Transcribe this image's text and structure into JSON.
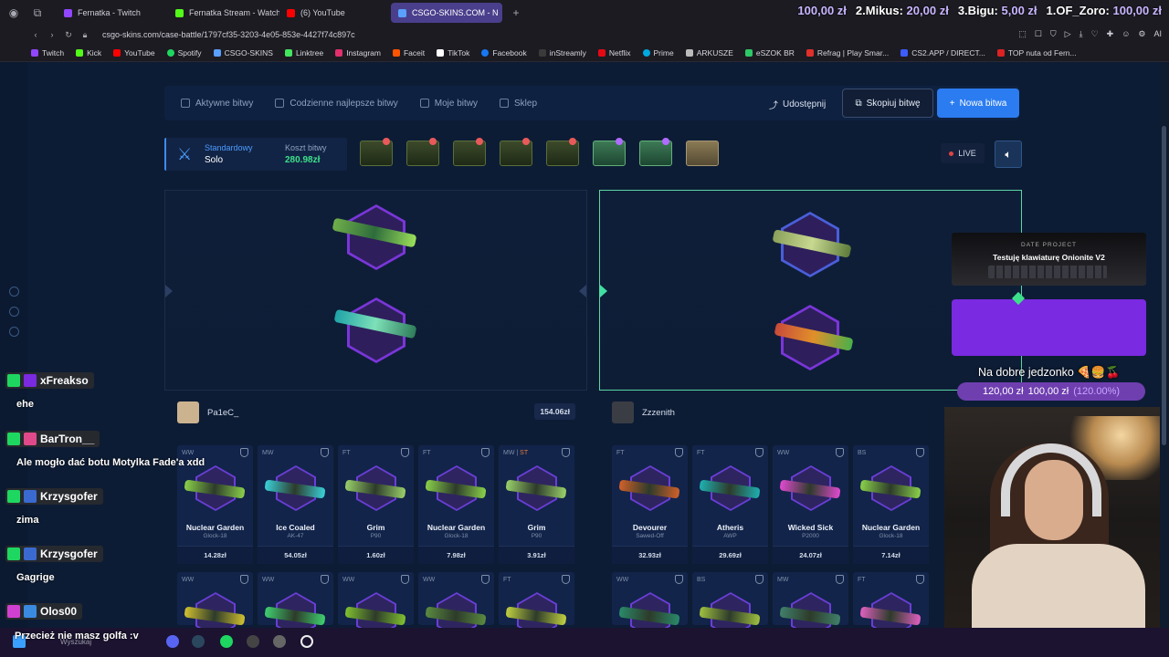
{
  "browser": {
    "tabs": [
      {
        "label": "Fernatka - Twitch",
        "color": "#9146ff"
      },
      {
        "label": "Fernatka Stream - Watch L",
        "color": "#53fc18"
      },
      {
        "label": "(6) YouTube",
        "color": "#ff0000"
      },
      {
        "label": "CSGO-SKINS.COM - N",
        "color": "#5aa0ff"
      }
    ],
    "new_tab": "+",
    "url": "csgo-skins.com/case-battle/1797cf35-3203-4e05-853e-4427f74c897c",
    "bookmarks": [
      {
        "label": "Twitch",
        "color": "#9146ff"
      },
      {
        "label": "Kick",
        "color": "#53fc18"
      },
      {
        "label": "YouTube",
        "color": "#ff0000"
      },
      {
        "label": "Spotify",
        "color": "#1ed760"
      },
      {
        "label": "CSGO-SKINS",
        "color": "#5aa0ff"
      },
      {
        "label": "Linktree",
        "color": "#43e55e"
      },
      {
        "label": "Instagram",
        "color": "#e1306c"
      },
      {
        "label": "Faceit",
        "color": "#ff5500"
      },
      {
        "label": "TikTok",
        "color": "#ffffff"
      },
      {
        "label": "Facebook",
        "color": "#1877f2"
      },
      {
        "label": "inStreamly",
        "color": "#3a3a3a"
      },
      {
        "label": "Netflix",
        "color": "#e50914"
      },
      {
        "label": "Prime",
        "color": "#00a8e1"
      },
      {
        "label": "ARKUSZE",
        "color": "#bbbbbb"
      },
      {
        "label": "eSZOK BR",
        "color": "#2ec866"
      },
      {
        "label": "Refrag | Play Smar...",
        "color": "#e0302a"
      },
      {
        "label": "CS2.APP / DIRECT...",
        "color": "#3c5cff"
      },
      {
        "label": "TOP nuta od Fern...",
        "color": "#d22"
      }
    ]
  },
  "donations": [
    {
      "name": "",
      "amount": "100,00 zł"
    },
    {
      "name": "2.Mikus:",
      "amount": "20,00 zł"
    },
    {
      "name": "3.Bigu:",
      "amount": "5,00 zł"
    },
    {
      "name": "1.OF_Zoro:",
      "amount": "100,00 zł"
    }
  ],
  "site": {
    "nav": [
      {
        "label": "Aktywne bitwy"
      },
      {
        "label": "Codzienne najlepsze bitwy"
      },
      {
        "label": "Moje bitwy"
      },
      {
        "label": "Sklep"
      }
    ],
    "share_label": "Udostępnij",
    "copy_label": "Skopiuj bitwę",
    "new_battle_label": "Nowa bitwa",
    "mode_label": "Standardowy",
    "mode_value": "Solo",
    "cost_label": "Koszt bitwy",
    "cost_value": "280.98zł",
    "live_label": "LIVE",
    "players": [
      {
        "name": "Pa1eC_",
        "total": "154.06zł",
        "items": [
          {
            "grade": "WW",
            "st": "",
            "name": "Nuclear Garden",
            "weapon": "Glock-18",
            "price": "14.28zł",
            "color": "#8ad04a"
          },
          {
            "grade": "MW",
            "st": "",
            "name": "Ice Coaled",
            "weapon": "AK-47",
            "price": "54.05zł",
            "color": "#3ad0d8"
          },
          {
            "grade": "FT",
            "st": "",
            "name": "Grim",
            "weapon": "P90",
            "price": "1.60zł",
            "color": "#9ad06a"
          },
          {
            "grade": "FT",
            "st": "",
            "name": "Nuclear Garden",
            "weapon": "Glock-18",
            "price": "7.98zł",
            "color": "#8ad04a"
          },
          {
            "grade": "MW |",
            "st": "ST",
            "name": "Grim",
            "weapon": "P90",
            "price": "3.91zł",
            "color": "#9ad06a"
          }
        ]
      },
      {
        "name": "Zzzenith",
        "total": "",
        "items": [
          {
            "grade": "FT",
            "st": "",
            "name": "Devourer",
            "weapon": "Sawed-Off",
            "price": "32.93zł",
            "color": "#d0602a"
          },
          {
            "grade": "FT",
            "st": "",
            "name": "Atheris",
            "weapon": "AWP",
            "price": "29.69zł",
            "color": "#1fb0b0"
          },
          {
            "grade": "WW",
            "st": "",
            "name": "Wicked Sick",
            "weapon": "P2000",
            "price": "24.07zł",
            "color": "#e04ad0"
          },
          {
            "grade": "BS",
            "st": "",
            "name": "Nuclear Garden",
            "weapon": "Glock-18",
            "price": "7.14zł",
            "color": "#8ad04a"
          }
        ]
      }
    ],
    "row2_left": [
      {
        "grade": "WW"
      },
      {
        "grade": "WW"
      },
      {
        "grade": "WW"
      },
      {
        "grade": "WW"
      },
      {
        "grade": "FT"
      }
    ],
    "row2_right": [
      {
        "grade": "WW"
      },
      {
        "grade": "BS"
      },
      {
        "grade": "MW"
      },
      {
        "grade": "FT"
      }
    ]
  },
  "chat": [
    {
      "user": "xFreakso",
      "text": "ehe",
      "color": "#ffffff"
    },
    {
      "user": "BarTron__",
      "text": "Ale mogło dać botu Motylka Fade'a xdd",
      "color": "#ffffff"
    },
    {
      "user": "Krzysgofer",
      "text": "zima",
      "color": "#ffffff"
    },
    {
      "user": "Krzysgofer",
      "text": "Gagrige",
      "color": "#ffffff"
    },
    {
      "user": "Olos00",
      "text": "Przecież nie masz golfa :v",
      "color": "#ffffff"
    }
  ],
  "overlay": {
    "promo_brand": "DATE PROJECT",
    "promo_title": "Testuję klawiaturę Onionite V2",
    "goal_title": "Na dobre jedzonko 🍕🍔🍒",
    "goal_current": "120,00 zł",
    "goal_target": "100,00 zł",
    "goal_percent": "(120.00%)"
  },
  "taskbar": {
    "search_label": "Wyszukaj"
  }
}
